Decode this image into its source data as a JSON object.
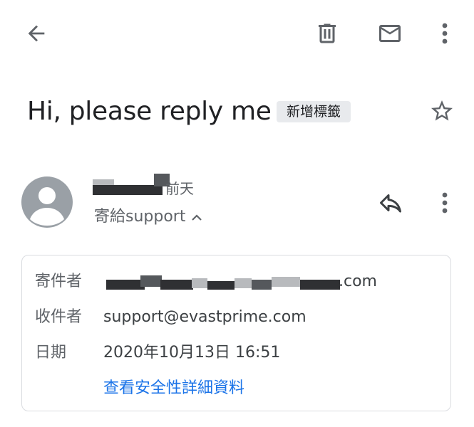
{
  "toolbar": {
    "back_icon": "arrow-back-icon",
    "delete_icon": "trash-icon",
    "mark_icon": "mail-icon",
    "more_icon": "more-vert-icon"
  },
  "email": {
    "subject": "Hi, please reply me",
    "label_chip": "新增標籤",
    "star_icon": "star-outline-icon",
    "time": "前天",
    "to_summary": "寄給support",
    "reply_icon": "reply-icon",
    "more_icon": "more-vert-icon"
  },
  "details": {
    "from_label": "寄件者",
    "from_value_visible_suffix": ".com",
    "to_label": "收件者",
    "to_value": "support@evastprime.com",
    "date_label": "日期",
    "date_value": "2020年10月13日 16:51",
    "view_details_link": "查看安全性詳細資料"
  },
  "colors": {
    "avatar_bg": "#9aa0a6",
    "chip_bg": "#e8eaed",
    "link": "#1a73e8",
    "icon": "#5f6368"
  }
}
